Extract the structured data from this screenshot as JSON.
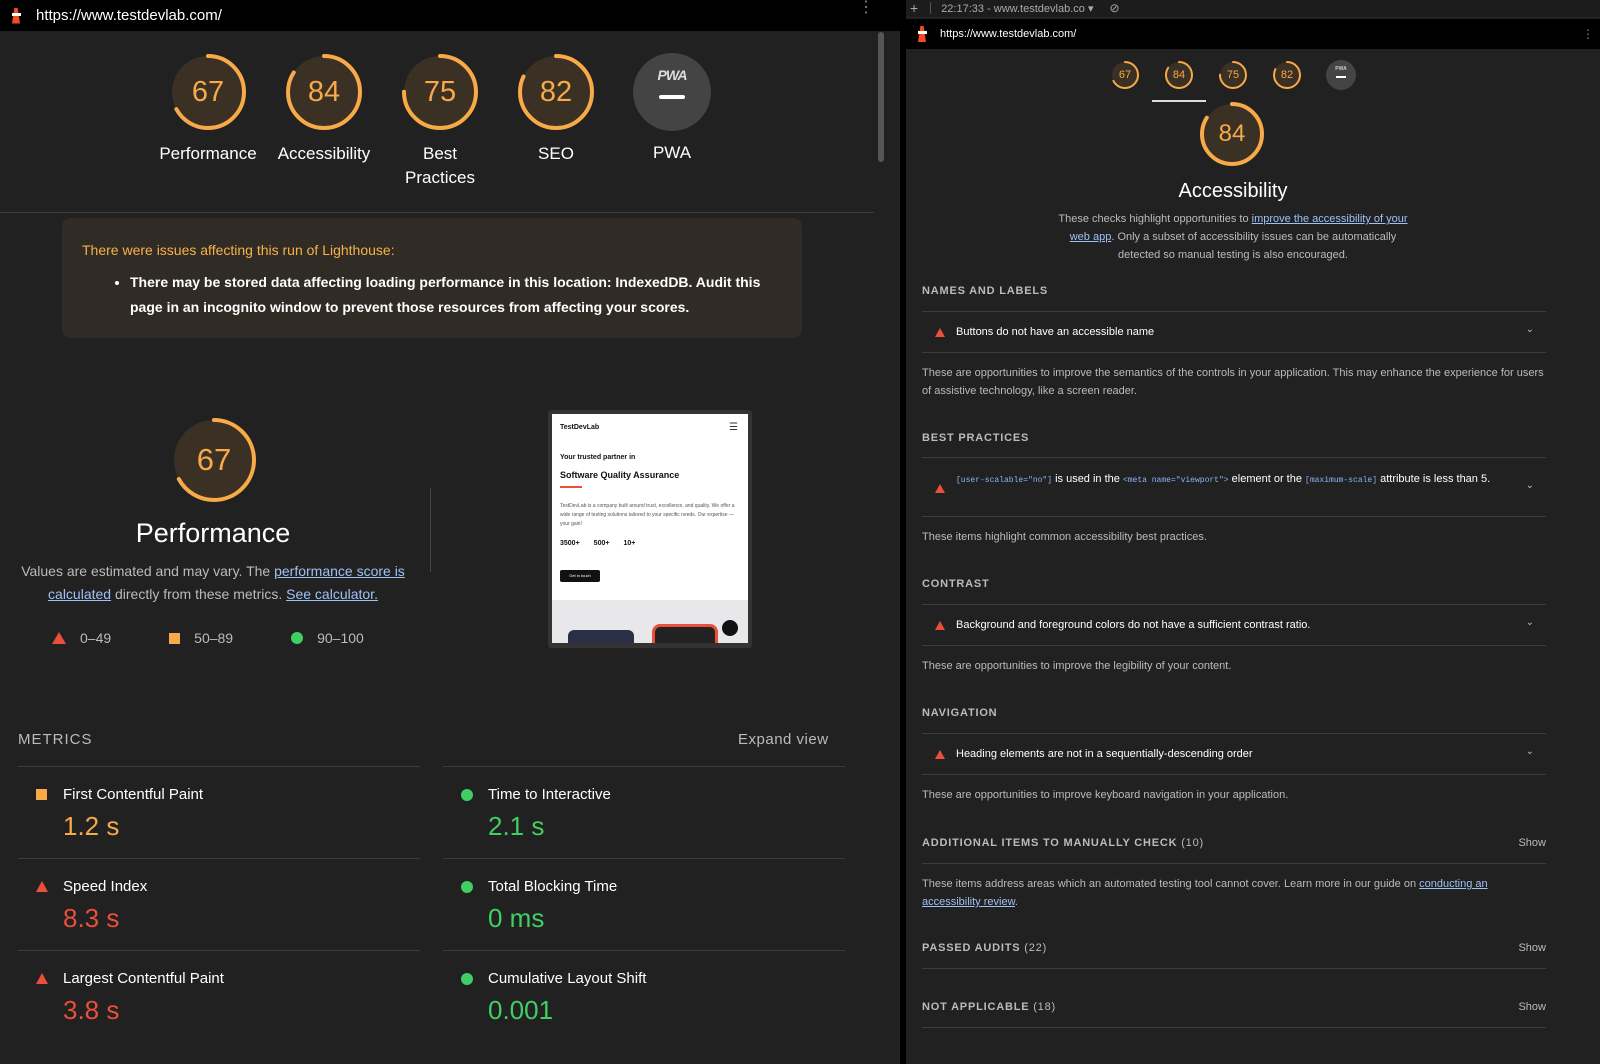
{
  "left": {
    "url": "https://www.testdevlab.com/",
    "gauges": [
      {
        "score": "67",
        "label": "Performance",
        "fraction": 0.67
      },
      {
        "score": "84",
        "label": "Accessibility",
        "fraction": 0.84
      },
      {
        "score": "75",
        "label": "Best Practices",
        "fraction": 0.75
      },
      {
        "score": "82",
        "label": "SEO",
        "fraction": 0.82
      }
    ],
    "pwa": {
      "badge": "PWA",
      "label": "PWA"
    },
    "warning": {
      "title": "There were issues affecting this run of Lighthouse:",
      "item": "There may be stored data affecting loading performance in this location: IndexedDB. Audit this page in an incognito window to prevent those resources from affecting your scores."
    },
    "performance": {
      "score": "67",
      "fraction": 0.67,
      "title": "Performance",
      "desc_pre": "Values are estimated and may vary. The ",
      "desc_link1": "performance score is calculated",
      "desc_mid": " directly from these metrics. ",
      "desc_link2": "See calculator."
    },
    "legend": {
      "red": "0–49",
      "orange": "50–89",
      "green": "90–100"
    },
    "screenshot": {
      "brand": "TestDevLab",
      "line1": "Your trusted partner in",
      "line2": "Software Quality Assurance",
      "body": "TestDevLab is a company built around trust, excellence, and quality. We offer a wide range of testing solutions tailored to your specific needs. Our expertise — your gain!",
      "stats": [
        "3500+",
        "500+",
        "10+"
      ],
      "cta": "Get in touch"
    },
    "metrics_heading": "METRICS",
    "expand_view": "Expand view",
    "metrics_left": [
      {
        "name": "First Contentful Paint",
        "value": "1.2 s",
        "status": "orange"
      },
      {
        "name": "Speed Index",
        "value": "8.3 s",
        "status": "red"
      },
      {
        "name": "Largest Contentful Paint",
        "value": "3.8 s",
        "status": "red"
      }
    ],
    "metrics_right": [
      {
        "name": "Time to Interactive",
        "value": "2.1 s",
        "status": "green"
      },
      {
        "name": "Total Blocking Time",
        "value": "0 ms",
        "status": "green"
      },
      {
        "name": "Cumulative Layout Shift",
        "value": "0.001",
        "status": "green"
      }
    ]
  },
  "right": {
    "tab_title": "22:17:33 - www.testdevlab.co",
    "url": "https://www.testdevlab.com/",
    "mini_scores": [
      "67",
      "84",
      "75",
      "82"
    ],
    "accessibility": {
      "score": "84",
      "fraction": 0.84,
      "title": "Accessibility",
      "desc_pre": "These checks highlight opportunities to ",
      "desc_link": "improve the accessibility of your web app",
      "desc_post": ". Only a subset of accessibility issues can be automatically detected so manual testing is also encouraged."
    },
    "groups": {
      "names": {
        "heading": "NAMES AND LABELS",
        "audit": "Buttons do not have an accessible name",
        "desc": "These are opportunities to improve the semantics of the controls in your application. This may enhance the experience for users of assistive technology, like a screen reader."
      },
      "best": {
        "heading": "BEST PRACTICES",
        "code1": "[user-scalable=\"no\"]",
        "t1": " is used in the ",
        "code2": "<meta name=\"viewport\">",
        "t2": " element or the ",
        "code3": "[maximum-scale]",
        "t3": " attribute is less than 5.",
        "desc": "These items highlight common accessibility best practices."
      },
      "contrast": {
        "heading": "CONTRAST",
        "audit": "Background and foreground colors do not have a sufficient contrast ratio.",
        "desc": "These are opportunities to improve the legibility of your content."
      },
      "navigation": {
        "heading": "NAVIGATION",
        "audit": "Heading elements are not in a sequentially-descending order",
        "desc": "These are opportunities to improve keyboard navigation in your application."
      },
      "manual": {
        "heading": "ADDITIONAL ITEMS TO MANUALLY CHECK",
        "count": "(10)",
        "show": "Show",
        "desc_pre": "These items address areas which an automated testing tool cannot cover. Learn more in our guide on ",
        "desc_link": "conducting an accessibility review",
        "desc_post": "."
      },
      "passed": {
        "heading": "PASSED AUDITS",
        "count": "(22)",
        "show": "Show"
      },
      "na": {
        "heading": "NOT APPLICABLE",
        "count": "(18)",
        "show": "Show"
      }
    }
  },
  "colors": {
    "orange": "#f8a948",
    "red": "#e94f3b",
    "green": "#3fcf63",
    "link": "#9fc2f5"
  }
}
